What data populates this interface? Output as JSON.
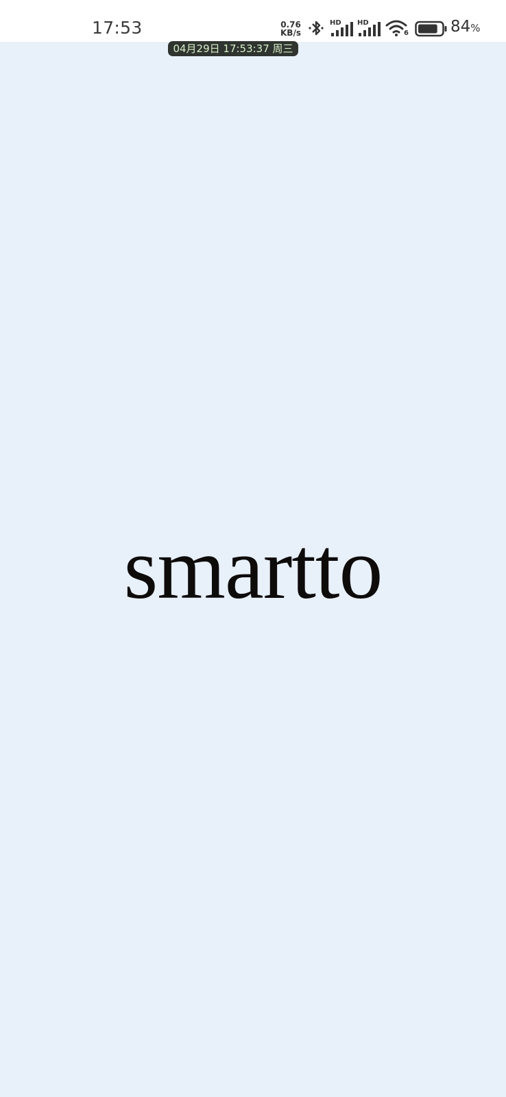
{
  "status_bar": {
    "time": "17:53",
    "net_speed_value": "0.76",
    "net_speed_unit": "KB/s",
    "signal_1_label": "HD",
    "signal_2_label": "HD",
    "wifi_badge": "6",
    "battery_level": 84,
    "battery_value": "84",
    "battery_unit": "%"
  },
  "date_overlay": "04月29日 17:53:37 周三",
  "splash": {
    "logo_text": "smartto"
  },
  "colors": {
    "background": "#e8f0f9",
    "status_bar": "#ffffff",
    "logo": "#0e0b0b"
  }
}
